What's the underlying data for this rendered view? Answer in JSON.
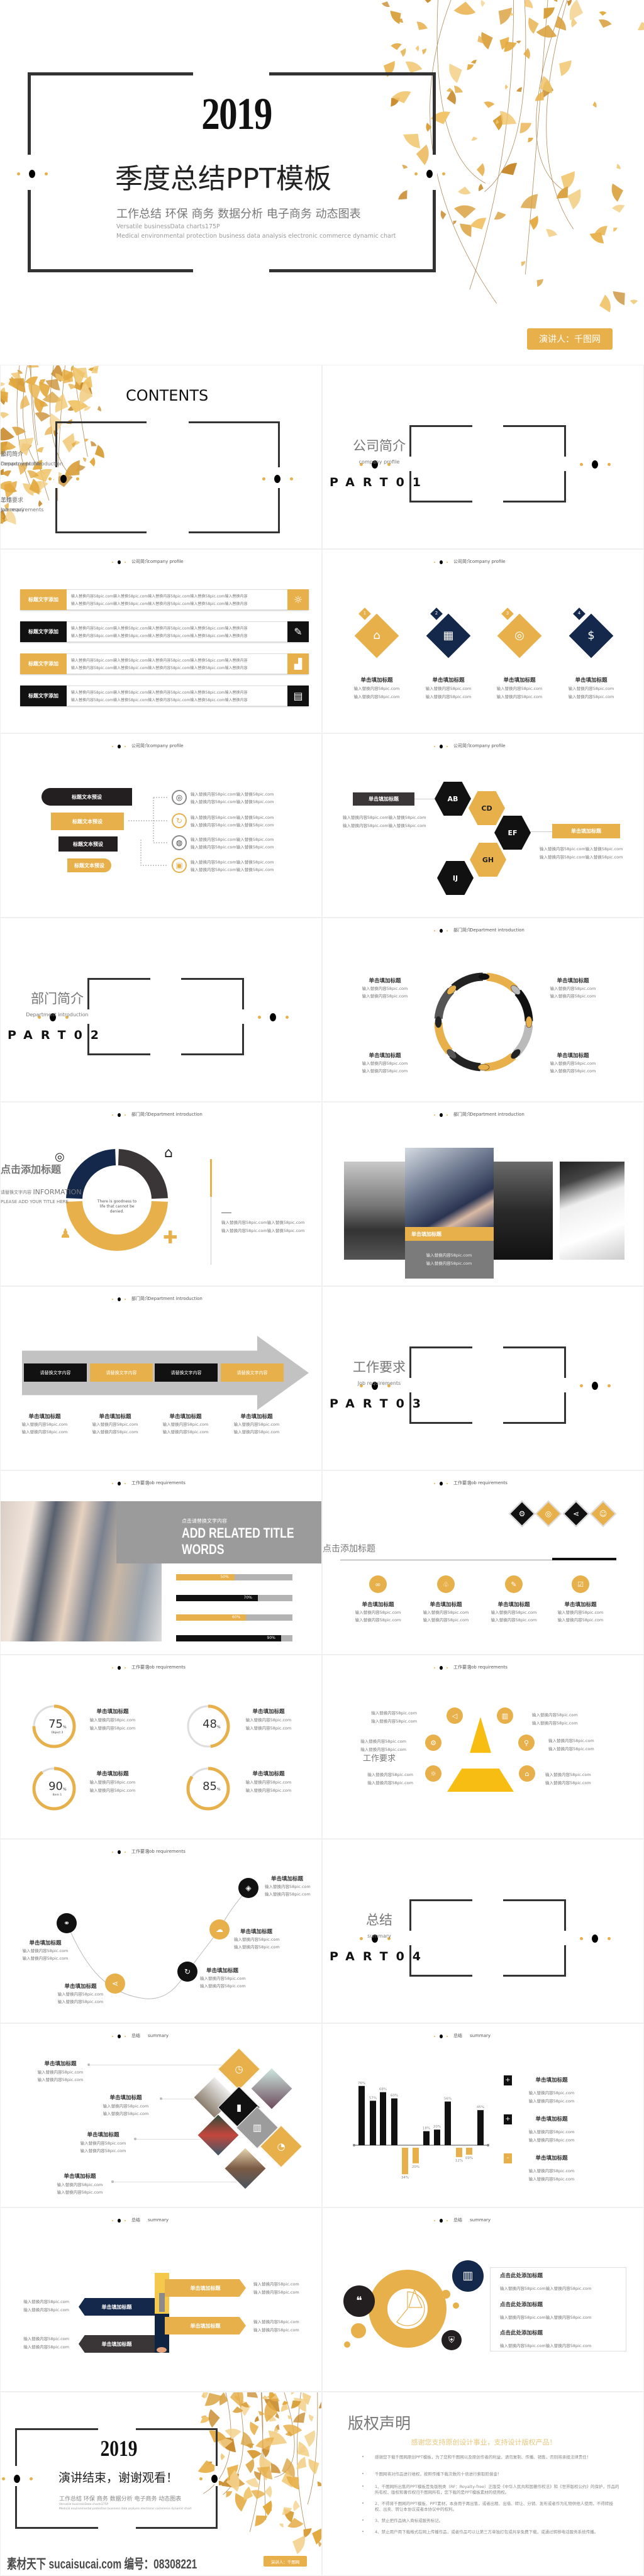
{
  "colors": {
    "gold": "#e8b04a",
    "dark": "#231f20",
    "navy": "#14284b",
    "gray": "#a3a3a3",
    "pyramid": "#f7bd13"
  },
  "cover": {
    "year": "2019",
    "title": "季度总结PPT模板",
    "subtitle": "工作总结 环保 商务 数据分析 电子商务 动态图表",
    "en_line1": "Versatile businessData charts175P",
    "en_line2": "Medical environmental protection business data analysis electronic commerce dynamic chart",
    "presenter": "演讲人：千图网"
  },
  "contents": {
    "title": "CONTENTS",
    "items": [
      {
        "cn": "公司简介",
        "en": "company profile"
      },
      {
        "cn": "部门简介",
        "en": "Department introduction"
      },
      {
        "cn": "工作要求",
        "en": "Job requirements"
      },
      {
        "cn": "总结",
        "en": "summary"
      }
    ]
  },
  "parts": [
    {
      "cn": "公司简介",
      "en": "company profile",
      "part": "PART01"
    },
    {
      "cn": "部门简介",
      "en": "Department introduction",
      "part": "PART02"
    },
    {
      "cn": "工作要求",
      "en": "Job requirements",
      "part": "PART03"
    },
    {
      "cn": "总结",
      "en": "summary",
      "part": "PART04"
    }
  ],
  "headers": {
    "company": {
      "cn": "公司简介",
      "en": "company profile"
    },
    "department": {
      "cn": "部门简介",
      "en": "Department introduction"
    },
    "job": {
      "cn": "工作要求",
      "en": "Job requirements"
    },
    "summary": {
      "cn": "总结",
      "en": "summary"
    }
  },
  "list_bars": {
    "items": [
      {
        "label": "标题文字添加",
        "icon": "lightbulb-icon",
        "lines": [
          "输入替换内容58pic.com输入替换58pic.com输入替换内容58pic.com输入替换58pic.com输入替换内容",
          "输入替换内容58pic.com输入替换58pic.com输入替换内容58pic.com输入替换58pic.com输入替换内容"
        ]
      },
      {
        "label": "标题文字添加",
        "icon": "edit-document-icon",
        "lines": [
          "输入替换内容58pic.com输入替换58pic.com输入替换内容58pic.com输入替换58pic.com输入替换内容",
          "输入替换内容58pic.com输入替换58pic.com输入替换内容58pic.com输入替换58pic.com输入替换内容"
        ]
      },
      {
        "label": "标题文字添加",
        "icon": "growth-chart-icon",
        "lines": [
          "输入替换内容58pic.com输入替换58pic.com输入替换内容58pic.com输入替换58pic.com输入替换内容",
          "输入替换内容58pic.com输入替换58pic.com输入替换内容58pic.com输入替换58pic.com输入替换内容"
        ]
      },
      {
        "label": "标题文字添加",
        "icon": "monitor-chart-icon",
        "lines": [
          "输入替换内容58pic.com输入替换58pic.com输入替换内容58pic.com输入替换58pic.com输入替换内容",
          "输入替换内容58pic.com输入替换58pic.com输入替换内容58pic.com输入替换58pic.com输入替换内容"
        ]
      }
    ]
  },
  "diamonds": {
    "items": [
      {
        "num": "1",
        "icon": "home-icon",
        "title": "单击填加标题",
        "lines": [
          "输入替换内容58pic.com",
          "输入替换内容58pic.com"
        ]
      },
      {
        "num": "2",
        "icon": "laptop-chart-icon",
        "title": "单击填加标题",
        "lines": [
          "输入替换内容58pic.com",
          "输入替换内容58pic.com"
        ]
      },
      {
        "num": "3",
        "icon": "target-search-icon",
        "title": "单击填加标题",
        "lines": [
          "输入替换内容58pic.com",
          "输入替换内容58pic.com"
        ]
      },
      {
        "num": "4",
        "icon": "money-bag-icon",
        "title": "单击填加标题",
        "lines": [
          "输入替换内容58pic.com",
          "输入替换内容58pic.com"
        ]
      }
    ]
  },
  "flow": {
    "labels": [
      "标题文本预设",
      "标题文本预设",
      "标题文本预设",
      "标题文本预设"
    ],
    "items": [
      {
        "icon": "target-icon",
        "lines": [
          "输入替换内容58pic.com输入替换58pic.com",
          "输入替换内容58pic.com输入替换58pic.com"
        ]
      },
      {
        "icon": "refresh-icon",
        "lines": [
          "输入替换内容58pic.com输入替换58pic.com",
          "输入替换内容58pic.com输入替换58pic.com"
        ]
      },
      {
        "icon": "globe-icon",
        "lines": [
          "输入替换内容58pic.com输入替换58pic.com",
          "输入替换内容58pic.com输入替换58pic.com"
        ]
      },
      {
        "icon": "calendar-icon",
        "lines": [
          "输入替换内容58pic.com输入替换58pic.com",
          "输入替换内容58pic.com输入替换58pic.com"
        ]
      }
    ]
  },
  "hexagons": {
    "cells": [
      "AB",
      "CD",
      "EF",
      "GH",
      "IJ"
    ],
    "boxes": [
      {
        "title": "单击填加标题",
        "lines": [
          "输入替换内容58pic.com输入替换58pic.com",
          "输入替换内容58pic.com输入替换58pic.com"
        ]
      },
      {
        "title": "单击填加标题",
        "lines": [
          "输入替换内容58pic.com输入替换58pic.com",
          "输入替换内容58pic.com输入替换58pic.com"
        ]
      }
    ]
  },
  "ring": {
    "items": [
      {
        "title": "单击填加标题",
        "lines": [
          "输入替换内容58pic.com",
          "输入替换内容58pic.com"
        ]
      },
      {
        "title": "单击填加标题",
        "lines": [
          "输入替换内容58pic.com",
          "输入替换内容58pic.com"
        ]
      },
      {
        "title": "单击填加标题",
        "lines": [
          "输入替换内容58pic.com",
          "输入替换内容58pic.com"
        ]
      },
      {
        "title": "单击填加标题",
        "lines": [
          "输入替换内容58pic.com",
          "输入替换内容58pic.com"
        ]
      }
    ]
  },
  "info": {
    "center_title": "INFORMATION",
    "center_text": "There is goodness to life that cannot be denied.",
    "title": "点击添加标题",
    "subtitle": "请替换文字内容",
    "en": "PLEASE ADD YOUR TITLE HERE",
    "lines": [
      "输入替换内容58pic.com输入替换58pic.com",
      "输入替换内容58pic.com输入替换58pic.com"
    ]
  },
  "photos": {
    "caption": "单击填加标题",
    "lines": [
      "输入替换内容58pic.com",
      "输入替换内容58pic.com"
    ]
  },
  "arrow": {
    "boxes": [
      "请替换文字内容",
      "请替换文字内容",
      "请替换文字内容",
      "请替换文字内容"
    ],
    "items": [
      {
        "title": "单击填加标题",
        "lines": [
          "输入替换内容58pic.com",
          "输入替换内容58pic.com"
        ]
      },
      {
        "title": "单击填加标题",
        "lines": [
          "输入替换内容58pic.com",
          "输入替换内容58pic.com"
        ]
      },
      {
        "title": "单击填加标题",
        "lines": [
          "输入替换内容58pic.com",
          "输入替换内容58pic.com"
        ]
      },
      {
        "title": "单击填加标题",
        "lines": [
          "输入替换内容58pic.com",
          "输入替换内容58pic.com"
        ]
      }
    ]
  },
  "progress": {
    "kicker": "点击请替换文字内容",
    "title_line1": "ADD RELATED TITLE",
    "title_line2": "WORDS",
    "bars": [
      {
        "value": 50,
        "label": "50%",
        "color": "#e8b04a"
      },
      {
        "value": 70,
        "label": "70%",
        "color": "#111111"
      },
      {
        "value": 60,
        "label": "60%",
        "color": "#e8b04a"
      },
      {
        "value": 90,
        "label": "90%",
        "color": "#111111"
      }
    ]
  },
  "icon_row": {
    "title": "点击添加标题",
    "diamond_icons": [
      "gear-icon",
      "target-icon",
      "share-icon",
      "user-icon"
    ],
    "items": [
      {
        "icon": "link-icon",
        "title": "单击填加标题",
        "lines": [
          "输入替换内容58pic.com",
          "输入替换内容58pic.com"
        ]
      },
      {
        "icon": "ribbon-icon",
        "title": "单击填加标题",
        "lines": [
          "输入替换内容58pic.com",
          "输入替换内容58pic.com"
        ]
      },
      {
        "icon": "pencil-icon",
        "title": "单击填加标题",
        "lines": [
          "输入替换内容58pic.com",
          "输入替换内容58pic.com"
        ]
      },
      {
        "icon": "checkbox-icon",
        "title": "单击填加标题",
        "lines": [
          "输入替换内容58pic.com",
          "输入替换内容58pic.com"
        ]
      }
    ]
  },
  "percent": {
    "items": [
      {
        "value": 75,
        "label": "Object 1",
        "title": "单击填加标题",
        "lines": [
          "输入替换内容58pic.com",
          "输入替换内容58pic.com"
        ]
      },
      {
        "value": 48,
        "label": "Object 2",
        "title": "单击填加标题",
        "lines": [
          "输入替换内容58pic.com",
          "输入替换内容58pic.com"
        ]
      },
      {
        "value": 90,
        "label": "Item 1",
        "title": "单击填加标题",
        "lines": [
          "输入替换内容58pic.com",
          "输入替换内容58pic.com"
        ]
      },
      {
        "value": 85,
        "label": "Item 1",
        "title": "单击填加标题",
        "lines": [
          "输入替换内容58pic.com",
          "输入替换内容58pic.com"
        ]
      }
    ]
  },
  "pyramid": {
    "center": "工作要求",
    "items": [
      {
        "icon": "megaphone-icon",
        "lines": [
          "输入替换内容58pic.com",
          "输入替换内容58pic.com"
        ]
      },
      {
        "icon": "bar-chart-icon",
        "lines": [
          "输入替换内容58pic.com",
          "输入替换内容58pic.com"
        ]
      },
      {
        "icon": "search-settings-icon",
        "lines": [
          "输入替换内容58pic.com",
          "输入替换内容58pic.com"
        ]
      },
      {
        "icon": "search-icon",
        "lines": [
          "输入替换内容58pic.com",
          "输入替换内容58pic.com"
        ]
      },
      {
        "icon": "lightbulb-icon",
        "lines": [
          "输入替换内容58pic.com",
          "输入替换内容58pic.com"
        ]
      },
      {
        "icon": "home-icon",
        "lines": [
          "输入替换内容58pic.com",
          "输入替换内容58pic.com"
        ]
      }
    ]
  },
  "curve": {
    "items": [
      {
        "icon": "link-icon",
        "title": "单击填加标题",
        "lines": [
          "输入替换内容58pic.com",
          "输入替换内容58pic.com"
        ]
      },
      {
        "icon": "share-icon",
        "title": "单击填加标题",
        "lines": [
          "输入替换内容58pic.com",
          "输入替换内容58pic.com"
        ]
      },
      {
        "icon": "refresh-icon",
        "title": "单击填加标题",
        "lines": [
          "输入替换内容58pic.com",
          "输入替换内容58pic.com"
        ]
      },
      {
        "icon": "cloud-icon",
        "title": "单击填加标题",
        "lines": [
          "输入替换内容58pic.com",
          "输入替换内容58pic.com"
        ]
      },
      {
        "icon": "drop-icon",
        "title": "单击填加标题",
        "lines": [
          "输入替换内容58pic.com",
          "输入替换内容58pic.com"
        ]
      }
    ]
  },
  "diamond_photos": {
    "items": [
      {
        "title": "单击填加标题",
        "lines": [
          "输入替换内容58pic.com",
          "输入替换内容58pic.com"
        ]
      },
      {
        "title": "单击填加标题",
        "lines": [
          "输入替换内容58pic.com",
          "输入替换内容58pic.com"
        ]
      },
      {
        "title": "单击填加标题",
        "lines": [
          "输入替换内容58pic.com",
          "输入替换内容58pic.com"
        ]
      },
      {
        "title": "单击填加标题",
        "lines": [
          "输入替换内容58pic.com",
          "输入替换内容58pic.com"
        ]
      }
    ]
  },
  "chart_data": {
    "type": "bar",
    "title": "",
    "xlabel": "",
    "ylabel": "",
    "values": [
      76,
      57,
      68,
      60,
      -34,
      -20,
      18,
      20,
      56,
      -12,
      -9,
      45
    ],
    "labels": [
      "76%",
      "57%",
      "68%",
      "60%",
      "34%",
      "20%",
      "18%",
      "20%",
      "56%",
      "12%",
      "09%",
      "45%"
    ],
    "positive_color": "#111111",
    "negative_color": "#e8b04a",
    "grid": false
  },
  "chart_legend": {
    "items": [
      {
        "symbol": "+",
        "color": "#111111",
        "title": "单击填加标题",
        "lines": [
          "输入替换内容58pic.com",
          "输入替换内容58pic.com"
        ]
      },
      {
        "symbol": "+",
        "color": "#111111",
        "title": "单击填加标题",
        "lines": [
          "输入替换内容58pic.com",
          "输入替换内容58pic.com"
        ]
      },
      {
        "symbol": "-",
        "color": "#e8b04a",
        "title": "单击填加标题",
        "lines": [
          "输入替换内容58pic.com",
          "输入替换内容58pic.com"
        ]
      }
    ]
  },
  "pencils": {
    "labels": [
      "单击填加标题",
      "单击填加标题",
      "单击填加标题",
      "单击填加标题"
    ],
    "texts": [
      [
        "输入替换内容58pic.com",
        "输入替换内容58pic.com"
      ],
      [
        "输入替换内容58pic.com",
        "输入替换内容58pic.com"
      ],
      [
        "输入替换内容58pic.com",
        "输入替换内容58pic.com"
      ],
      [
        "输入替换内容58pic.com",
        "输入替换内容58pic.com"
      ]
    ]
  },
  "circle_chart": {
    "items": [
      {
        "title": "点击此处添加标题",
        "line": "输入替换内容58pic.com输入替换内容58pic.com"
      },
      {
        "title": "点击此处添加标题",
        "line": "输入替换内容58pic.com输入替换内容58pic.com"
      },
      {
        "title": "点击此处添加标题",
        "line": "输入替换内容58pic.com输入替换内容58pic.com"
      }
    ]
  },
  "ending": {
    "year": "2019",
    "title": "演讲结束，谢谢观看！",
    "subtitle": "工作总结 环保 商务 数据分析 电子商务 动态图表",
    "en_line1": "Versatile businessData charts175P",
    "en_line2": "Medical environmental protection business data analysis electronic commerce dynamic chart",
    "presenter": "演讲人：千图网"
  },
  "copyright": {
    "title": "版权声明",
    "subtitle": "感谢您支持原创设计事业，支持设计版权产品！",
    "bullets": [
      "感谢您下载千图网原创PPT模板，为了您和千图网以及原创作者的利益，请勿复制、传播、销售，否则将承担法律责任！",
      "千图网将对作品进行维权，按照传播下载次数的十倍进行索取赔偿金！",
      "1、千图网所出售的PPT模板是免版税类（RF：Royalty-free）正版受《中华人民共和国著作权法》和《世界版权公约》的保护，作品的所有权、版权和著作权归千图网所有，您下载的是PPT模板素材的使用权。",
      "2、不得将千图网的PPT模板、PPT素材，本身用于再出售，或者出租、出借、转让、分销、发布或者作为礼物供他人使用，不得转授权、出卖、转让本协议或者本协议中的权利。",
      "3、禁止把作品纳入商标或服务标记。",
      "4、禁止用户用下载格式在网上传播作品，或者作品可以让第三方单独打包或共享免费下载，或通过转移电话服务系统传播。"
    ]
  },
  "watermark": "素材天下 sucaisucai.com  编号：08308221"
}
